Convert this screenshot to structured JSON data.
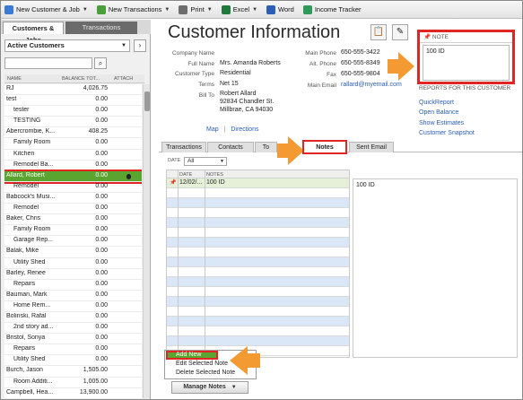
{
  "toolbar": {
    "items": [
      {
        "label": "New Customer & Job",
        "icon": "new-customer-icon",
        "color": "#3a7bd5"
      },
      {
        "label": "New Transactions",
        "icon": "new-transactions-icon",
        "color": "#4a9f3a"
      },
      {
        "label": "Print",
        "icon": "print-icon",
        "color": "#6c6c6c"
      },
      {
        "label": "Excel",
        "icon": "excel-icon",
        "color": "#1e7a3d"
      },
      {
        "label": "Word",
        "icon": "word-icon",
        "color": "#2b5fb5"
      },
      {
        "label": "Income Tracker",
        "icon": "income-tracker-icon",
        "color": "#2f9a59"
      }
    ]
  },
  "left": {
    "tab_active": "Customers & Jobs",
    "tab_inactive": "Transactions",
    "filter_value": "Active Customers",
    "columns": [
      "NAME",
      "BALANCE TOT...",
      "ATTACH"
    ],
    "rows": [
      {
        "name": "RJ",
        "balance": "4,026.75",
        "indent": 0
      },
      {
        "name": "test",
        "balance": "0.00",
        "indent": 0
      },
      {
        "name": "tester",
        "balance": "0.00",
        "indent": 1
      },
      {
        "name": "TESTING",
        "balance": "0.00",
        "indent": 1
      },
      {
        "name": "Abercrombie, K...",
        "balance": "408.25",
        "indent": 0
      },
      {
        "name": "Family Room",
        "balance": "0.00",
        "indent": 1
      },
      {
        "name": "Kitchen",
        "balance": "0.00",
        "indent": 1
      },
      {
        "name": "Remodel Ba...",
        "balance": "0.00",
        "indent": 1
      },
      {
        "name": "Allard, Robert",
        "balance": "0.00",
        "indent": 0,
        "selected": true,
        "attach": true
      },
      {
        "name": "Remodel",
        "balance": "0.00",
        "indent": 1
      },
      {
        "name": "Babcock's Musi...",
        "balance": "0.00",
        "indent": 0
      },
      {
        "name": "Remodel",
        "balance": "0.00",
        "indent": 1
      },
      {
        "name": "Baker, Chris",
        "balance": "0.00",
        "indent": 0
      },
      {
        "name": "Family Room",
        "balance": "0.00",
        "indent": 1
      },
      {
        "name": "Garage Rep...",
        "balance": "0.00",
        "indent": 1
      },
      {
        "name": "Balak, Mike",
        "balance": "0.00",
        "indent": 0
      },
      {
        "name": "Utility Shed",
        "balance": "0.00",
        "indent": 1
      },
      {
        "name": "Barley, Renee",
        "balance": "0.00",
        "indent": 0
      },
      {
        "name": "Repairs",
        "balance": "0.00",
        "indent": 1
      },
      {
        "name": "Bauman, Mark",
        "balance": "0.00",
        "indent": 0
      },
      {
        "name": "Home Rem...",
        "balance": "0.00",
        "indent": 1
      },
      {
        "name": "Bolinski, Rafal",
        "balance": "0.00",
        "indent": 0
      },
      {
        "name": "2nd story ad...",
        "balance": "0.00",
        "indent": 1
      },
      {
        "name": "Bristol, Sonya",
        "balance": "0.00",
        "indent": 0
      },
      {
        "name": "Repairs",
        "balance": "0.00",
        "indent": 1
      },
      {
        "name": "Utility Shed",
        "balance": "0.00",
        "indent": 1
      },
      {
        "name": "Burch, Jason",
        "balance": "1,505.00",
        "indent": 0
      },
      {
        "name": "Room Additi...",
        "balance": "1,005.00",
        "indent": 1
      },
      {
        "name": "Campbell, Hea...",
        "balance": "13,900.00",
        "indent": 0
      }
    ]
  },
  "customer": {
    "title": "Customer Information",
    "labels": {
      "company": "Company Name",
      "full_name": "Full Name",
      "type": "Customer Type",
      "terms": "Terms",
      "bill_to": "Bill To",
      "main_phone": "Main Phone",
      "alt_phone": "Alt. Phone",
      "fax": "Fax",
      "main_email": "Main Email"
    },
    "full_name": "Mrs. Amanda  Roberts",
    "type": "Residential",
    "terms": "Net 15",
    "bill_to": [
      "Robert Allard",
      "92834 Chandler St.",
      "Millbrae, CA 94030"
    ],
    "main_phone": "650-555-3422",
    "alt_phone": "650-555-8349",
    "fax": "650-555-9804",
    "main_email": "rallard@myemail.com",
    "map_link": "Map",
    "directions_link": "Directions"
  },
  "note": {
    "heading": "NOTE",
    "text": "100 ID"
  },
  "reports": {
    "heading": "REPORTS FOR THIS CUSTOMER",
    "links": [
      "QuickReport",
      "Open Balance",
      "Show Estimates",
      "Customer Snapshot"
    ]
  },
  "notes_tabs": [
    "Transactions",
    "Contacts",
    "To",
    "Notes",
    "Sent Email"
  ],
  "notes_tab_active": "Notes",
  "date_filter": {
    "label": "DATE",
    "value": "All"
  },
  "notes_grid": {
    "columns": [
      "DATE",
      "NOTES"
    ],
    "rows": [
      {
        "date": "12/02/...",
        "note": "100 ID"
      }
    ],
    "detail": "100 ID"
  },
  "context_menu": {
    "items": [
      "Add New",
      "Edit Selected Note",
      "Delete Selected Note"
    ],
    "highlighted": "Add New"
  },
  "manage_notes_label": "Manage Notes",
  "colors": {
    "selected_green": "#5aa52f",
    "callout_red": "#e12525",
    "arrow_orange": "#f39a32",
    "link_blue": "#2a5db0"
  }
}
